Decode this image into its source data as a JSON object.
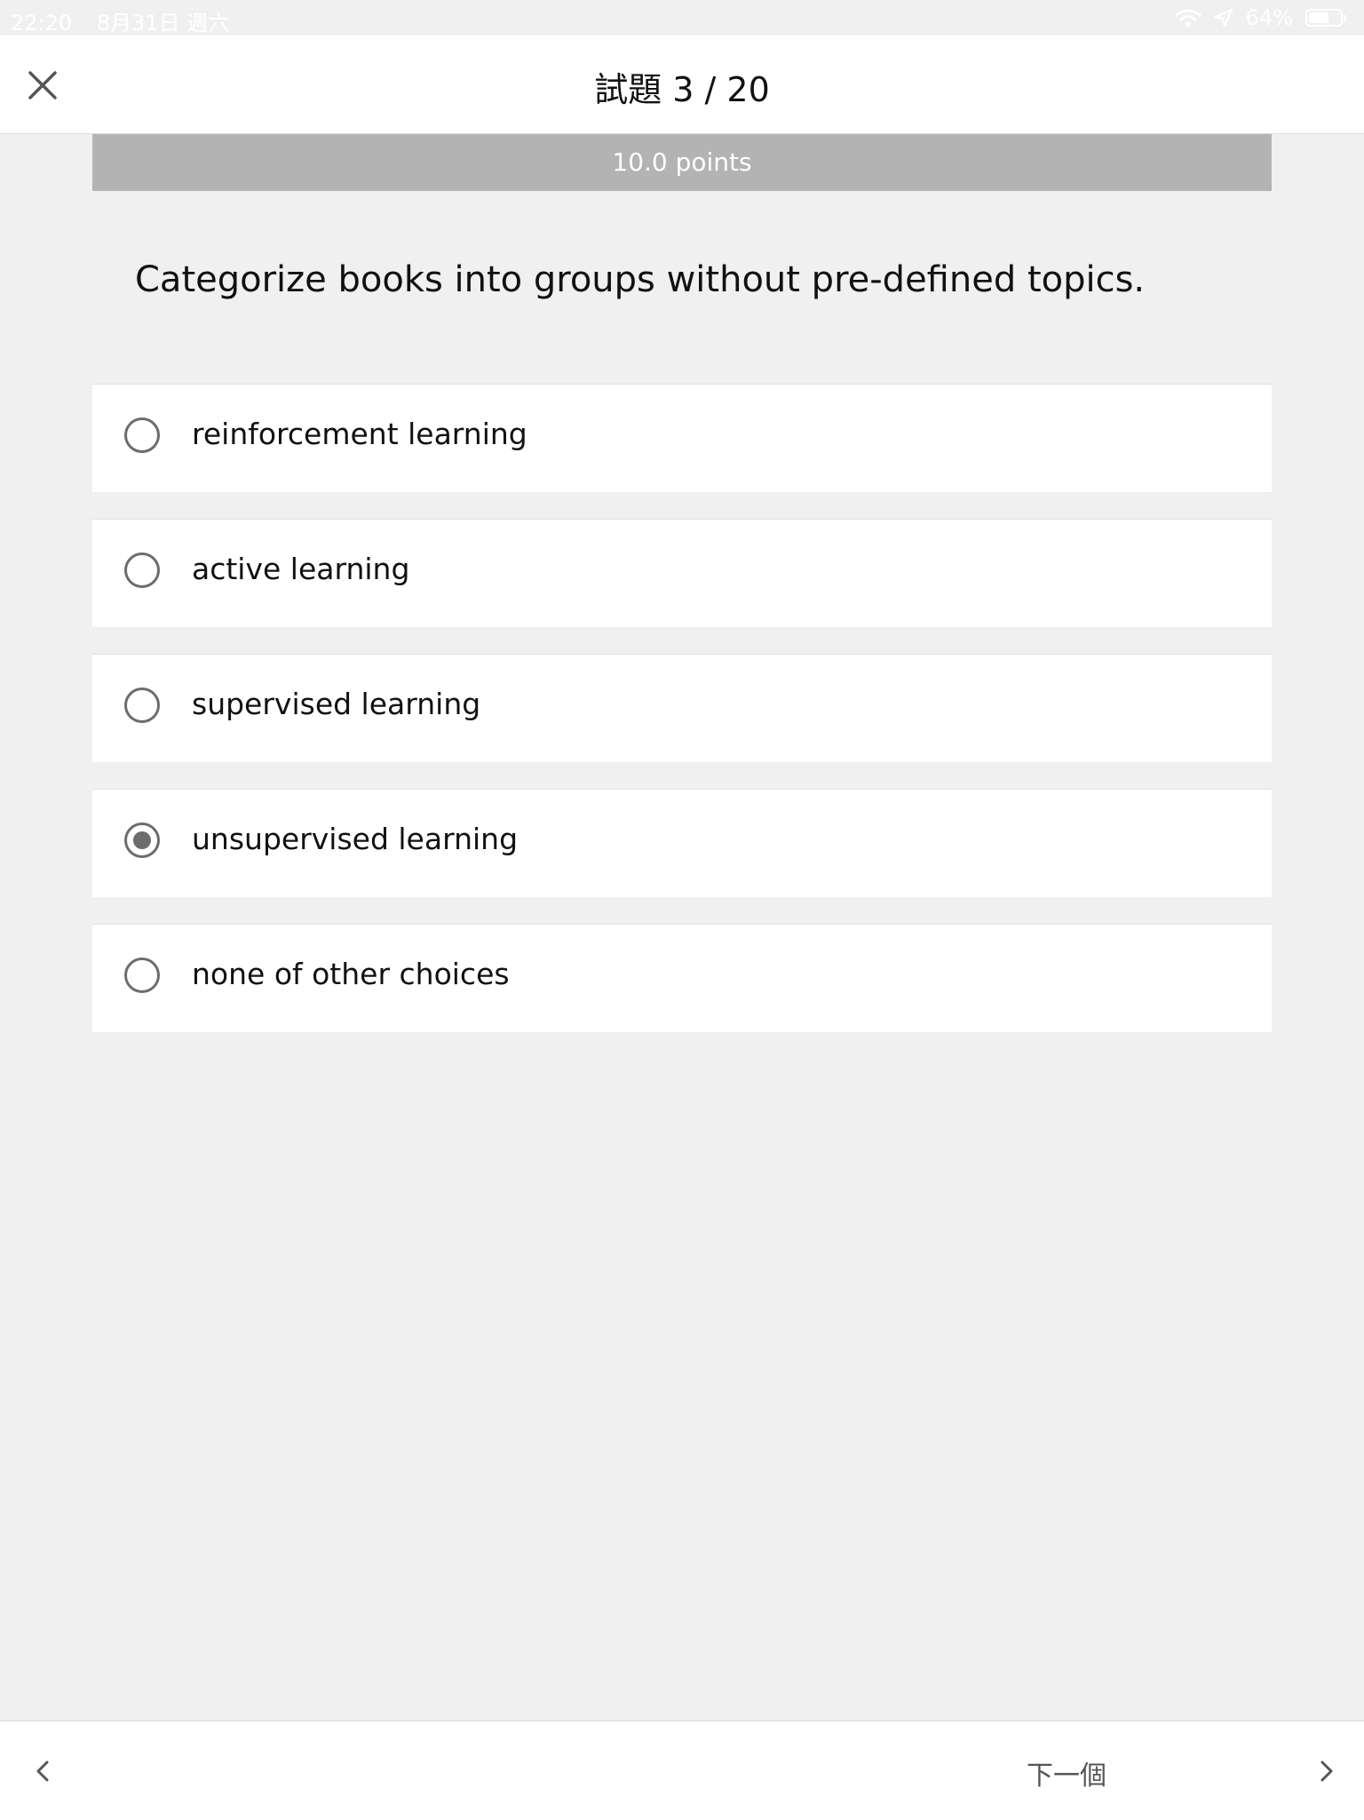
{
  "status_bar": {
    "time": "22:20",
    "date": "8月31日 週六",
    "battery_percent": "64%",
    "battery_level": 0.64,
    "icons": [
      "wifi-icon",
      "location-icon",
      "battery-icon"
    ]
  },
  "header": {
    "title": "試題 3 / 20",
    "close_icon": "close-icon"
  },
  "points": "10.0 points",
  "question": "Categorize books into groups without pre-defined topics.",
  "choices": [
    {
      "label": "reinforcement learning",
      "selected": false
    },
    {
      "label": "active learning",
      "selected": false
    },
    {
      "label": "supervised learning",
      "selected": false
    },
    {
      "label": "unsupervised learning",
      "selected": true
    },
    {
      "label": "none of other choices",
      "selected": false
    }
  ],
  "footer": {
    "next_label": "下一個",
    "prev_icon": "chevron-left-icon",
    "next_icon": "chevron-right-icon"
  },
  "colors": {
    "background": "#f0f0f0",
    "points_bar": "#b3b3b3",
    "radio": "#6c6c6c"
  }
}
